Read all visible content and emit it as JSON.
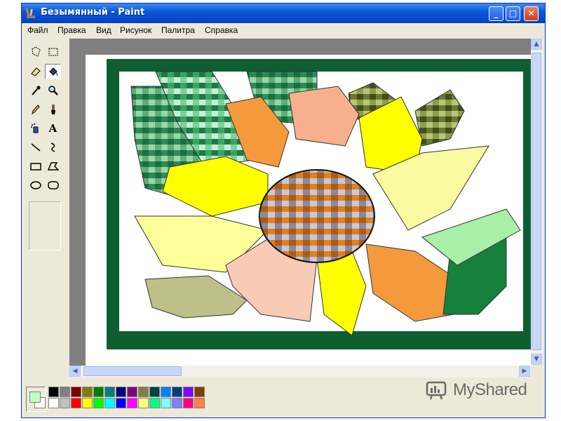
{
  "window": {
    "title": "Безымянный - Paint",
    "controls": {
      "minimize": "_",
      "maximize": "□",
      "close": "✕"
    }
  },
  "menu": {
    "items": [
      "Файл",
      "Правка",
      "Вид",
      "Рисунок",
      "Палитра",
      "Справка"
    ]
  },
  "toolbox": {
    "tools": [
      "free-select-icon",
      "rect-select-icon",
      "eraser-icon",
      "fill-bucket-icon",
      "color-picker-icon",
      "magnifier-icon",
      "pencil-icon",
      "brush-icon",
      "airbrush-icon",
      "text-icon",
      "line-icon",
      "curve-icon",
      "rectangle-icon",
      "polygon-icon",
      "ellipse-icon",
      "rounded-rect-icon"
    ],
    "selected_tool": "fill-bucket-icon",
    "text_tool_glyph": "A"
  },
  "palette": {
    "foreground": "#c0ffc0",
    "background": "#ffffff",
    "row1": [
      "#000000",
      "#808080",
      "#800000",
      "#808000",
      "#008000",
      "#008080",
      "#000080",
      "#800080",
      "#808040",
      "#004040",
      "#0080ff",
      "#004080",
      "#8000ff",
      "#804000"
    ],
    "row2": [
      "#ffffff",
      "#c0c0c0",
      "#ff0000",
      "#ffff00",
      "#00ff00",
      "#00ffff",
      "#0000ff",
      "#ff00ff",
      "#ffff80",
      "#00ff80",
      "#80ffff",
      "#8080ff",
      "#ff0080",
      "#ff8040"
    ]
  },
  "watermark": {
    "text": "MyShared"
  },
  "artwork": {
    "frame_color": "#0e5e32",
    "petal_colors": {
      "orange": "#f59a3c",
      "salmon": "#f7b08b",
      "yellow": "#ffff00",
      "pale_yellow": "#ffff99",
      "light_yellow": "#fafaa0",
      "peach": "#f9cbb7",
      "khaki": "#bfbf8a",
      "dark_green": "#16803c",
      "light_green": "#a8f0a8"
    }
  }
}
